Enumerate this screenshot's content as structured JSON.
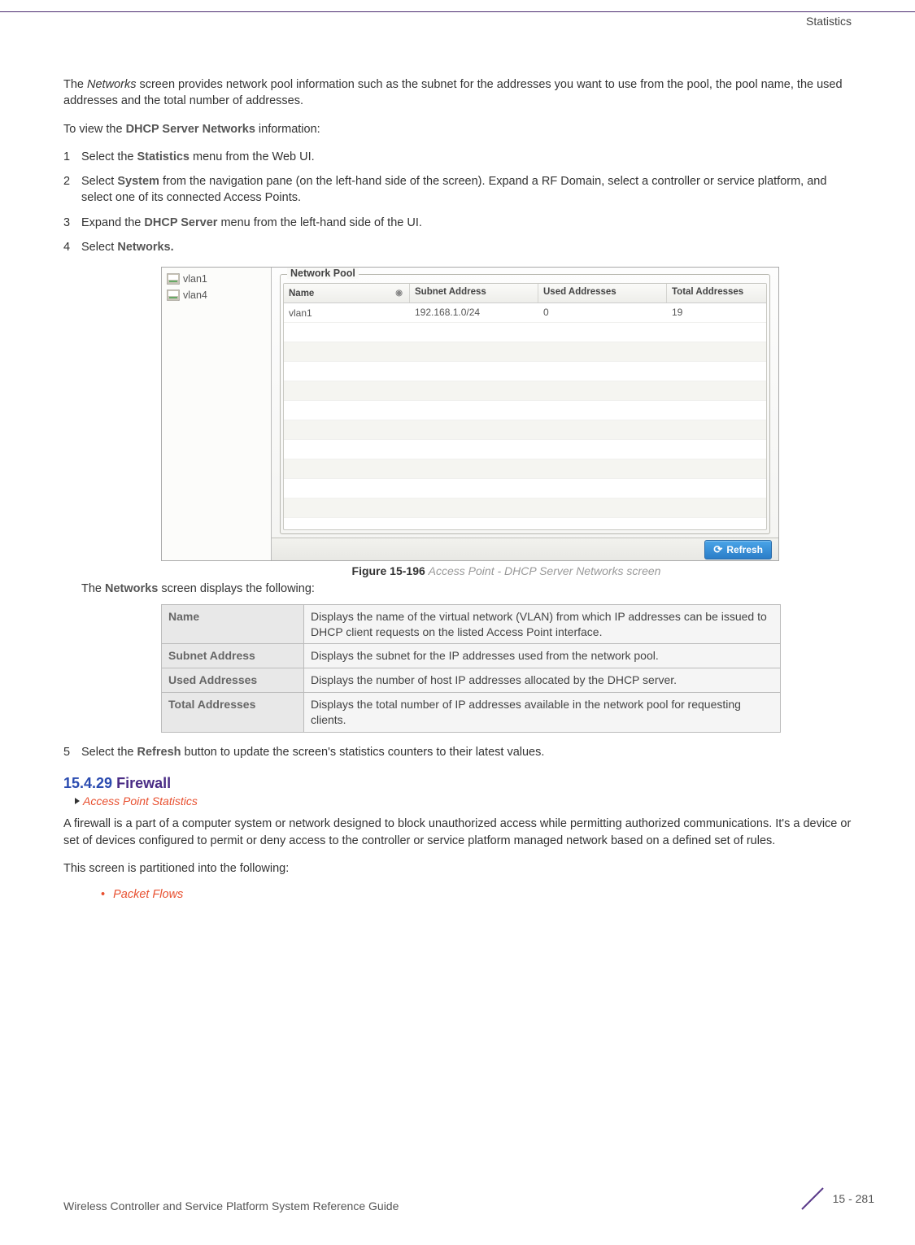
{
  "header": {
    "section": "Statistics"
  },
  "intro": {
    "p1_a": "The ",
    "p1_italic": "Networks",
    "p1_b": " screen provides network pool information such as the subnet for the addresses you want to use from the pool, the pool name, the used addresses and the total number of addresses.",
    "p2_a": "To view the ",
    "p2_bold": "DHCP Server Networks",
    "p2_b": " information:"
  },
  "steps": [
    {
      "n": "1",
      "a": "Select the ",
      "b": "Statistics",
      "c": " menu from the Web UI."
    },
    {
      "n": "2",
      "a": "Select ",
      "b": "System",
      "c": " from the navigation pane (on the left-hand side of the screen). Expand a RF Domain, select a controller or service platform, and select one of its connected Access Points."
    },
    {
      "n": "3",
      "a": "Expand the ",
      "b": "DHCP Server",
      "c": " menu from the left-hand side of the UI."
    },
    {
      "n": "4",
      "a": "Select ",
      "b": "Networks.",
      "c": ""
    }
  ],
  "figure": {
    "sidebar": [
      "vlan1",
      "vlan4"
    ],
    "legend": "Network Pool",
    "columns": {
      "name": "Name",
      "subnet": "Subnet Address",
      "used": "Used Addresses",
      "total": "Total Addresses"
    },
    "rows": [
      {
        "name": "vlan1",
        "subnet": "192.168.1.0/24",
        "used": "0",
        "total": "19"
      }
    ],
    "refresh": "Refresh",
    "caption_bold": "Figure 15-196",
    "caption_italic": "Access Point - DHCP Server Networks screen"
  },
  "desc_intro_a": "The ",
  "desc_intro_bold": "Networks",
  "desc_intro_b": " screen displays the following:",
  "defs": [
    {
      "term": "Name",
      "def": "Displays the name of the virtual network (VLAN) from which IP addresses can be issued to DHCP client requests on the listed Access Point interface."
    },
    {
      "term": "Subnet Address",
      "def": "Displays the subnet for the IP addresses used from the network pool."
    },
    {
      "term": "Used Addresses",
      "def": "Displays the number of host IP addresses allocated by the DHCP server."
    },
    {
      "term": "Total Addresses",
      "def": "Displays the total number of IP addresses available in the network pool for requesting clients."
    }
  ],
  "step5": {
    "n": "5",
    "a": "Select the ",
    "b": "Refresh",
    "c": " button to update the screen's statistics counters to their latest values."
  },
  "section": {
    "num": "15.4.29",
    "name": "Firewall",
    "breadcrumb": "Access Point Statistics"
  },
  "body": {
    "p1": "A firewall is a part of a computer system or network designed to block unauthorized access while permitting authorized communications. It's a device or set of devices configured to permit or deny access to the controller or service platform managed network based on a defined set of rules.",
    "p2": "This screen is partitioned into the following:"
  },
  "bullets": [
    "Packet Flows"
  ],
  "footer": {
    "title": "Wireless Controller and Service Platform System Reference Guide",
    "page": "15 - 281"
  }
}
